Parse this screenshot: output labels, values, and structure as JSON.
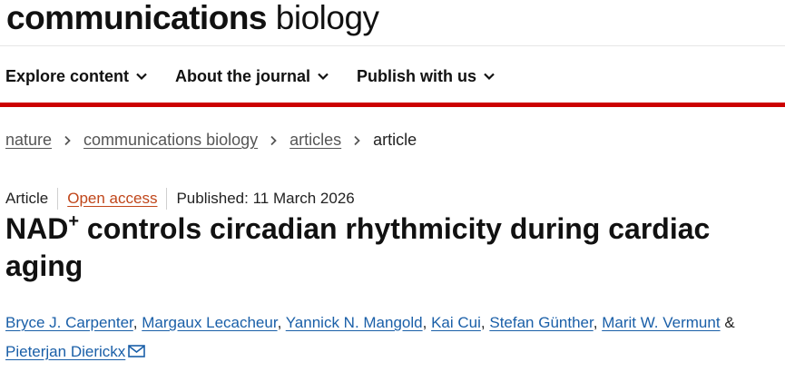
{
  "brand": {
    "bold": "communications",
    "light": " biology"
  },
  "nav": [
    {
      "label": "Explore content",
      "icon": "chevron-down-icon"
    },
    {
      "label": "About the journal",
      "icon": "chevron-down-icon"
    },
    {
      "label": "Publish with us",
      "icon": "chevron-down-icon"
    }
  ],
  "breadcrumb": [
    "nature",
    "communications biology",
    "articles",
    "article"
  ],
  "meta": {
    "type": "Article",
    "access": "Open access",
    "published": "Published: 11 March 2026"
  },
  "title": {
    "pre": "NAD",
    "sup": "+",
    "post": " controls circadian rhythmicity during cardiac aging"
  },
  "authors": [
    "Bryce J. Carpenter",
    "Margaux Lecacheur",
    "Yannick N. Mangold",
    "Kai Cui",
    "Stefan Günther",
    "Marit W. Vermunt",
    "Pieterjan Dierickx"
  ],
  "author_separators": {
    "comma": ",",
    "amp": "&"
  },
  "colors": {
    "accent_red": "#cc0000",
    "link_blue": "#1a5fa8",
    "open_access_orange": "#c0461a"
  }
}
